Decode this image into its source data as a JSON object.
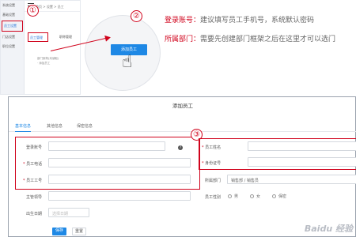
{
  "mini_screenshot": {
    "sidebar_items": [
      "系统设置",
      "基础设置",
      "员工设置",
      "门店设置",
      "职位设置"
    ],
    "active_sidebar_index": 2,
    "breadcrumb": "首页 > 设置 > 员工",
    "tabs": [
      "员工管理",
      "职称管理"
    ],
    "body_lines": [
      "部门架构(未读取)",
      "· 添加员工"
    ]
  },
  "steps": [
    "①",
    "②",
    "③"
  ],
  "zoom": {
    "button_label": "添加员工"
  },
  "notes": [
    {
      "label": "登录账号：",
      "text": "建议填写员工手机号，系统默认密码"
    },
    {
      "label": "所属部门：",
      "text": "需要先创建部门框架之后在这里才可以选门"
    }
  ],
  "modal": {
    "title": "添加员工",
    "tabs": [
      "基本信息",
      "其他信息",
      "保密信息"
    ],
    "active_tab": 0,
    "fields": {
      "login": {
        "label": "登录账号",
        "required": false,
        "value": ""
      },
      "phone": {
        "label": "员工电话",
        "required": true,
        "value": ""
      },
      "employee_no": {
        "label": "员工工号",
        "required": true,
        "value": ""
      },
      "supervisor": {
        "label": "主管领导",
        "value": ""
      },
      "birthday": {
        "label": "出生日期",
        "placeholder": "选择日期"
      },
      "name": {
        "label": "员工姓名",
        "required": true,
        "value": ""
      },
      "id_card": {
        "label": "身份证号",
        "required": true,
        "value": ""
      },
      "department": {
        "label": "所属部门",
        "value": "销售部 / 销售员"
      },
      "gender": {
        "label": "员工性别",
        "options": [
          "男",
          "女",
          "保密"
        ]
      }
    },
    "help_icon": "?",
    "buttons": {
      "save": "保存",
      "reset": "重置"
    }
  },
  "watermark": "Baidu 经验",
  "colors": {
    "accent_red": "#d0021b",
    "primary_blue": "#1e88e5"
  }
}
